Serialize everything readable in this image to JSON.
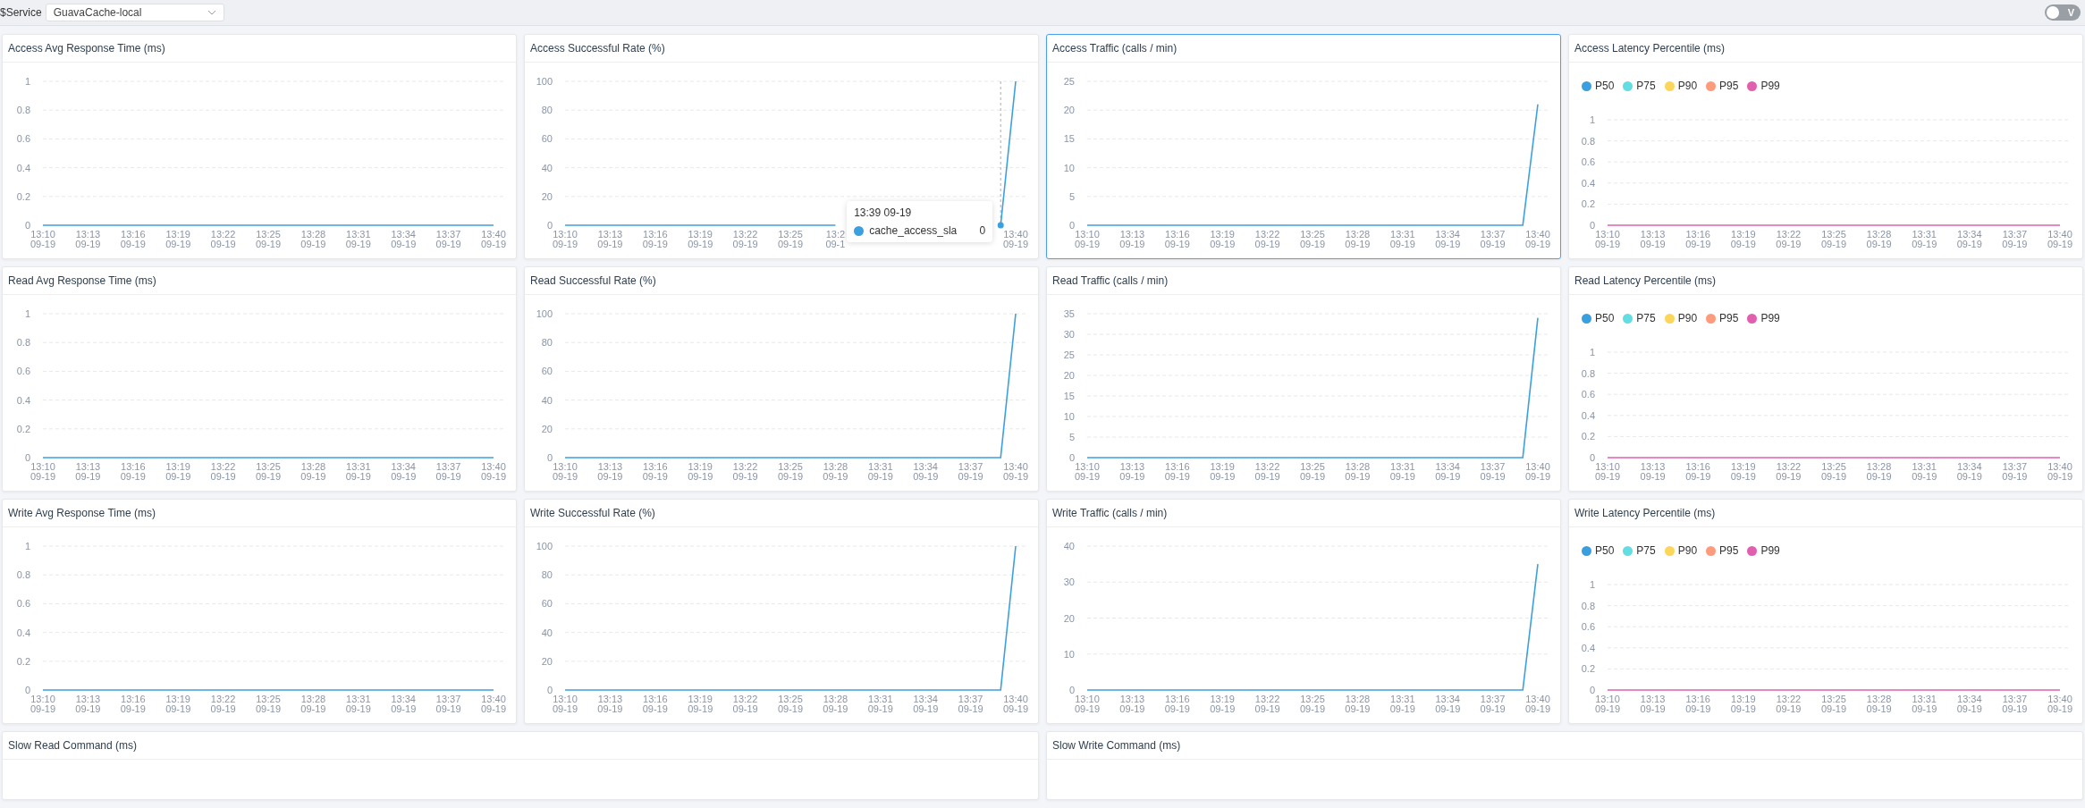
{
  "filter": {
    "label": "$Service",
    "value": "GuavaCache-local"
  },
  "toggle": {
    "label": "V",
    "on": false
  },
  "panels": [
    {
      "title": "Access Avg Response Time (ms)",
      "selected": false,
      "chart_data": {
        "type": "line",
        "grid": true,
        "ylim": [
          0,
          1
        ],
        "yticks": [
          0,
          0.2,
          0.4,
          0.6,
          0.8,
          1
        ],
        "categories": [
          "13:10\n09-19",
          null,
          null,
          "13:13\n09-19",
          null,
          null,
          "13:16\n09-19",
          null,
          null,
          "13:19\n09-19",
          null,
          null,
          "13:22\n09-19",
          null,
          null,
          "13:25\n09-19",
          null,
          null,
          "13:28\n09-19",
          null,
          null,
          "13:31\n09-19",
          null,
          null,
          "13:34\n09-19",
          null,
          null,
          "13:37\n09-19",
          null,
          null,
          "13:40\n09-19"
        ],
        "series": [
          {
            "color": "#3ba0e0",
            "values": [
              0,
              0,
              0,
              0,
              0,
              0,
              0,
              0,
              0,
              0,
              0,
              0,
              0,
              0,
              0,
              0,
              0,
              0,
              0,
              0,
              0,
              0,
              0,
              0,
              0,
              0,
              0,
              0,
              0,
              0,
              0
            ]
          }
        ]
      }
    },
    {
      "title": "Access Successful Rate (%)",
      "selected": false,
      "chart_data": {
        "type": "line",
        "grid": true,
        "ylim": [
          0,
          100
        ],
        "yticks": [
          0,
          20,
          40,
          60,
          80,
          100
        ],
        "categories": [
          "13:10\n09-19",
          null,
          null,
          "13:13\n09-19",
          null,
          null,
          "13:16\n09-19",
          null,
          null,
          "13:19\n09-19",
          null,
          null,
          "13:22\n09-19",
          null,
          null,
          "13:25\n09-19",
          null,
          null,
          "13:2\n09-1",
          null,
          null,
          null,
          null,
          null,
          null,
          null,
          null,
          null,
          null,
          null,
          "13:40\n09-19"
        ],
        "series": [
          {
            "color": "#3ba0e0",
            "values": [
              0,
              0,
              0,
              0,
              0,
              0,
              0,
              0,
              0,
              0,
              0,
              0,
              0,
              0,
              0,
              0,
              0,
              0,
              0,
              null,
              null,
              null,
              null,
              null,
              null,
              null,
              null,
              null,
              null,
              0,
              100
            ]
          }
        ]
      },
      "tooltip": {
        "title": "13:39 09-19",
        "items": [
          {
            "name": "cache_access_sla",
            "value": "0",
            "color": "#3ba0e0"
          }
        ]
      }
    },
    {
      "title": "Access Traffic (calls / min)",
      "selected": true,
      "chart_data": {
        "type": "line",
        "grid": true,
        "ylim": [
          0,
          25
        ],
        "yticks": [
          0,
          5,
          10,
          15,
          20,
          25
        ],
        "categories": [
          "13:10\n09-19",
          null,
          null,
          "13:13\n09-19",
          null,
          null,
          "13:16\n09-19",
          null,
          null,
          "13:19\n09-19",
          null,
          null,
          "13:22\n09-19",
          null,
          null,
          "13:25\n09-19",
          null,
          null,
          "13:28\n09-19",
          null,
          null,
          "13:31\n09-19",
          null,
          null,
          "13:34\n09-19",
          null,
          null,
          "13:37\n09-19",
          null,
          null,
          "13:40\n09-19"
        ],
        "series": [
          {
            "color": "#3ba0e0",
            "values": [
              0,
              0,
              0,
              0,
              0,
              0,
              0,
              0,
              0,
              0,
              0,
              0,
              0,
              0,
              0,
              0,
              0,
              0,
              0,
              0,
              0,
              0,
              0,
              0,
              0,
              0,
              0,
              0,
              0,
              0,
              21
            ]
          }
        ]
      }
    },
    {
      "title": "Access Latency Percentile (ms)",
      "selected": false,
      "legend": true,
      "chart_data": {
        "type": "line",
        "grid": true,
        "ylim": [
          0,
          1
        ],
        "yticks": [
          0,
          0.2,
          0.4,
          0.6,
          0.8,
          1
        ],
        "categories": [
          "13:10\n09-19",
          null,
          null,
          "13:13\n09-19",
          null,
          null,
          "13:16\n09-19",
          null,
          null,
          "13:19\n09-19",
          null,
          null,
          "13:22\n09-19",
          null,
          null,
          "13:25\n09-19",
          null,
          null,
          "13:28\n09-19",
          null,
          null,
          "13:31\n09-19",
          null,
          null,
          "13:34\n09-19",
          null,
          null,
          "13:37\n09-19",
          null,
          null,
          "13:40\n09-19"
        ],
        "series": [
          {
            "name": "P50",
            "color": "#3a9fde",
            "values": [
              null,
              null,
              null,
              null,
              null,
              null,
              null,
              null,
              null,
              null,
              null,
              null,
              null,
              null,
              null,
              null,
              null,
              null,
              null,
              null,
              null,
              null,
              null,
              null,
              null,
              null,
              null,
              null,
              null,
              null,
              null
            ]
          },
          {
            "name": "P75",
            "color": "#62dde1",
            "values": [
              null,
              null,
              null,
              null,
              null,
              null,
              null,
              null,
              null,
              null,
              null,
              null,
              null,
              null,
              null,
              null,
              null,
              null,
              null,
              null,
              null,
              null,
              null,
              null,
              null,
              null,
              null,
              null,
              null,
              null,
              null
            ]
          },
          {
            "name": "P90",
            "color": "#fcd65c",
            "values": [
              null,
              null,
              null,
              null,
              null,
              null,
              null,
              null,
              null,
              null,
              null,
              null,
              null,
              null,
              null,
              null,
              null,
              null,
              null,
              null,
              null,
              null,
              null,
              null,
              null,
              null,
              null,
              null,
              null,
              null,
              null
            ]
          },
          {
            "name": "P95",
            "color": "#fd9b7d",
            "values": [
              null,
              null,
              null,
              null,
              null,
              null,
              null,
              null,
              null,
              null,
              null,
              null,
              null,
              null,
              null,
              null,
              null,
              null,
              null,
              null,
              null,
              null,
              null,
              null,
              null,
              null,
              null,
              null,
              null,
              null,
              null
            ]
          },
          {
            "name": "P99",
            "color": "#e060ae",
            "values": [
              0,
              0,
              0,
              0,
              0,
              0,
              0,
              0,
              0,
              0,
              0,
              0,
              0,
              0,
              0,
              0,
              0,
              0,
              0,
              0,
              0,
              0,
              0,
              0,
              0,
              0,
              0,
              0,
              0,
              0,
              0
            ]
          }
        ]
      }
    },
    {
      "title": "Read Avg Response Time (ms)",
      "selected": false,
      "chart_data": {
        "type": "line",
        "grid": true,
        "ylim": [
          0,
          1
        ],
        "yticks": [
          0,
          0.2,
          0.4,
          0.6,
          0.8,
          1
        ],
        "categories": [
          "13:10\n09-19",
          null,
          null,
          "13:13\n09-19",
          null,
          null,
          "13:16\n09-19",
          null,
          null,
          "13:19\n09-19",
          null,
          null,
          "13:22\n09-19",
          null,
          null,
          "13:25\n09-19",
          null,
          null,
          "13:28\n09-19",
          null,
          null,
          "13:31\n09-19",
          null,
          null,
          "13:34\n09-19",
          null,
          null,
          "13:37\n09-19",
          null,
          null,
          "13:40\n09-19"
        ],
        "series": [
          {
            "color": "#3ba0e0",
            "values": [
              0,
              0,
              0,
              0,
              0,
              0,
              0,
              0,
              0,
              0,
              0,
              0,
              0,
              0,
              0,
              0,
              0,
              0,
              0,
              0,
              0,
              0,
              0,
              0,
              0,
              0,
              0,
              0,
              0,
              0,
              0
            ]
          }
        ]
      }
    },
    {
      "title": "Read Successful Rate (%)",
      "selected": false,
      "chart_data": {
        "type": "line",
        "grid": true,
        "ylim": [
          0,
          100
        ],
        "yticks": [
          0,
          20,
          40,
          60,
          80,
          100
        ],
        "categories": [
          "13:10\n09-19",
          null,
          null,
          "13:13\n09-19",
          null,
          null,
          "13:16\n09-19",
          null,
          null,
          "13:19\n09-19",
          null,
          null,
          "13:22\n09-19",
          null,
          null,
          "13:25\n09-19",
          null,
          null,
          "13:28\n09-19",
          null,
          null,
          "13:31\n09-19",
          null,
          null,
          "13:34\n09-19",
          null,
          null,
          "13:37\n09-19",
          null,
          null,
          "13:40\n09-19"
        ],
        "series": [
          {
            "color": "#3ba0e0",
            "values": [
              0,
              0,
              0,
              0,
              0,
              0,
              0,
              0,
              0,
              0,
              0,
              0,
              0,
              0,
              0,
              0,
              0,
              0,
              0,
              0,
              0,
              0,
              0,
              0,
              0,
              0,
              0,
              0,
              0,
              0,
              100
            ]
          }
        ]
      }
    },
    {
      "title": "Read Traffic (calls / min)",
      "selected": false,
      "chart_data": {
        "type": "line",
        "grid": true,
        "ylim": [
          0,
          35
        ],
        "yticks": [
          0,
          5,
          10,
          15,
          20,
          25,
          30,
          35
        ],
        "categories": [
          "13:10\n09-19",
          null,
          null,
          "13:13\n09-19",
          null,
          null,
          "13:16\n09-19",
          null,
          null,
          "13:19\n09-19",
          null,
          null,
          "13:22\n09-19",
          null,
          null,
          "13:25\n09-19",
          null,
          null,
          "13:28\n09-19",
          null,
          null,
          "13:31\n09-19",
          null,
          null,
          "13:34\n09-19",
          null,
          null,
          "13:37\n09-19",
          null,
          null,
          "13:40\n09-19"
        ],
        "series": [
          {
            "color": "#3ba0e0",
            "values": [
              0,
              0,
              0,
              0,
              0,
              0,
              0,
              0,
              0,
              0,
              0,
              0,
              0,
              0,
              0,
              0,
              0,
              0,
              0,
              0,
              0,
              0,
              0,
              0,
              0,
              0,
              0,
              0,
              0,
              0,
              34
            ]
          }
        ]
      }
    },
    {
      "title": "Read Latency Percentile (ms)",
      "selected": false,
      "legend": true,
      "chart_data": {
        "type": "line",
        "grid": true,
        "ylim": [
          0,
          1
        ],
        "yticks": [
          0,
          0.2,
          0.4,
          0.6,
          0.8,
          1
        ],
        "categories": [
          "13:10\n09-19",
          null,
          null,
          "13:13\n09-19",
          null,
          null,
          "13:16\n09-19",
          null,
          null,
          "13:19\n09-19",
          null,
          null,
          "13:22\n09-19",
          null,
          null,
          "13:25\n09-19",
          null,
          null,
          "13:28\n09-19",
          null,
          null,
          "13:31\n09-19",
          null,
          null,
          "13:34\n09-19",
          null,
          null,
          "13:37\n09-19",
          null,
          null,
          "13:40\n09-19"
        ],
        "series": [
          {
            "name": "P50",
            "color": "#3a9fde",
            "values": [
              null,
              null,
              null,
              null,
              null,
              null,
              null,
              null,
              null,
              null,
              null,
              null,
              null,
              null,
              null,
              null,
              null,
              null,
              null,
              null,
              null,
              null,
              null,
              null,
              null,
              null,
              null,
              null,
              null,
              null,
              null
            ]
          },
          {
            "name": "P75",
            "color": "#62dde1",
            "values": [
              null,
              null,
              null,
              null,
              null,
              null,
              null,
              null,
              null,
              null,
              null,
              null,
              null,
              null,
              null,
              null,
              null,
              null,
              null,
              null,
              null,
              null,
              null,
              null,
              null,
              null,
              null,
              null,
              null,
              null,
              null
            ]
          },
          {
            "name": "P90",
            "color": "#fcd65c",
            "values": [
              null,
              null,
              null,
              null,
              null,
              null,
              null,
              null,
              null,
              null,
              null,
              null,
              null,
              null,
              null,
              null,
              null,
              null,
              null,
              null,
              null,
              null,
              null,
              null,
              null,
              null,
              null,
              null,
              null,
              null,
              null
            ]
          },
          {
            "name": "P95",
            "color": "#fd9b7d",
            "values": [
              null,
              null,
              null,
              null,
              null,
              null,
              null,
              null,
              null,
              null,
              null,
              null,
              null,
              null,
              null,
              null,
              null,
              null,
              null,
              null,
              null,
              null,
              null,
              null,
              null,
              null,
              null,
              null,
              null,
              null,
              null
            ]
          },
          {
            "name": "P99",
            "color": "#e060ae",
            "values": [
              0,
              0,
              0,
              0,
              0,
              0,
              0,
              0,
              0,
              0,
              0,
              0,
              0,
              0,
              0,
              0,
              0,
              0,
              0,
              0,
              0,
              0,
              0,
              0,
              0,
              0,
              0,
              0,
              0,
              0,
              0
            ]
          }
        ]
      }
    },
    {
      "title": "Write Avg Response Time (ms)",
      "selected": false,
      "chart_data": {
        "type": "line",
        "grid": true,
        "ylim": [
          0,
          1
        ],
        "yticks": [
          0,
          0.2,
          0.4,
          0.6,
          0.8,
          1
        ],
        "categories": [
          "13:10\n09-19",
          null,
          null,
          "13:13\n09-19",
          null,
          null,
          "13:16\n09-19",
          null,
          null,
          "13:19\n09-19",
          null,
          null,
          "13:22\n09-19",
          null,
          null,
          "13:25\n09-19",
          null,
          null,
          "13:28\n09-19",
          null,
          null,
          "13:31\n09-19",
          null,
          null,
          "13:34\n09-19",
          null,
          null,
          "13:37\n09-19",
          null,
          null,
          "13:40\n09-19"
        ],
        "series": [
          {
            "color": "#3ba0e0",
            "values": [
              0,
              0,
              0,
              0,
              0,
              0,
              0,
              0,
              0,
              0,
              0,
              0,
              0,
              0,
              0,
              0,
              0,
              0,
              0,
              0,
              0,
              0,
              0,
              0,
              0,
              0,
              0,
              0,
              0,
              0,
              0
            ]
          }
        ]
      }
    },
    {
      "title": "Write Successful Rate (%)",
      "selected": false,
      "chart_data": {
        "type": "line",
        "grid": true,
        "ylim": [
          0,
          100
        ],
        "yticks": [
          0,
          20,
          40,
          60,
          80,
          100
        ],
        "categories": [
          "13:10\n09-19",
          null,
          null,
          "13:13\n09-19",
          null,
          null,
          "13:16\n09-19",
          null,
          null,
          "13:19\n09-19",
          null,
          null,
          "13:22\n09-19",
          null,
          null,
          "13:25\n09-19",
          null,
          null,
          "13:28\n09-19",
          null,
          null,
          "13:31\n09-19",
          null,
          null,
          "13:34\n09-19",
          null,
          null,
          "13:37\n09-19",
          null,
          null,
          "13:40\n09-19"
        ],
        "series": [
          {
            "color": "#3ba0e0",
            "values": [
              0,
              0,
              0,
              0,
              0,
              0,
              0,
              0,
              0,
              0,
              0,
              0,
              0,
              0,
              0,
              0,
              0,
              0,
              0,
              0,
              0,
              0,
              0,
              0,
              0,
              0,
              0,
              0,
              0,
              0,
              100
            ]
          }
        ]
      }
    },
    {
      "title": "Write Traffic (calls / min)",
      "selected": false,
      "chart_data": {
        "type": "line",
        "grid": true,
        "ylim": [
          0,
          40
        ],
        "yticks": [
          0,
          10,
          20,
          30,
          40
        ],
        "categories": [
          "13:10\n09-19",
          null,
          null,
          "13:13\n09-19",
          null,
          null,
          "13:16\n09-19",
          null,
          null,
          "13:19\n09-19",
          null,
          null,
          "13:22\n09-19",
          null,
          null,
          "13:25\n09-19",
          null,
          null,
          "13:28\n09-19",
          null,
          null,
          "13:31\n09-19",
          null,
          null,
          "13:34\n09-19",
          null,
          null,
          "13:37\n09-19",
          null,
          null,
          "13:40\n09-19"
        ],
        "series": [
          {
            "color": "#3ba0e0",
            "values": [
              0,
              0,
              0,
              0,
              0,
              0,
              0,
              0,
              0,
              0,
              0,
              0,
              0,
              0,
              0,
              0,
              0,
              0,
              0,
              0,
              0,
              0,
              0,
              0,
              0,
              0,
              0,
              0,
              0,
              0,
              35
            ]
          }
        ]
      }
    },
    {
      "title": "Write Latency Percentile (ms)",
      "selected": false,
      "legend": true,
      "chart_data": {
        "type": "line",
        "grid": true,
        "ylim": [
          0,
          1
        ],
        "yticks": [
          0,
          0.2,
          0.4,
          0.6,
          0.8,
          1
        ],
        "categories": [
          "13:10\n09-19",
          null,
          null,
          "13:13\n09-19",
          null,
          null,
          "13:16\n09-19",
          null,
          null,
          "13:19\n09-19",
          null,
          null,
          "13:22\n09-19",
          null,
          null,
          "13:25\n09-19",
          null,
          null,
          "13:28\n09-19",
          null,
          null,
          "13:31\n09-19",
          null,
          null,
          "13:34\n09-19",
          null,
          null,
          "13:37\n09-19",
          null,
          null,
          "13:40\n09-19"
        ],
        "series": [
          {
            "name": "P50",
            "color": "#3a9fde",
            "values": [
              null,
              null,
              null,
              null,
              null,
              null,
              null,
              null,
              null,
              null,
              null,
              null,
              null,
              null,
              null,
              null,
              null,
              null,
              null,
              null,
              null,
              null,
              null,
              null,
              null,
              null,
              null,
              null,
              null,
              null,
              null
            ]
          },
          {
            "name": "P75",
            "color": "#62dde1",
            "values": [
              null,
              null,
              null,
              null,
              null,
              null,
              null,
              null,
              null,
              null,
              null,
              null,
              null,
              null,
              null,
              null,
              null,
              null,
              null,
              null,
              null,
              null,
              null,
              null,
              null,
              null,
              null,
              null,
              null,
              null,
              null
            ]
          },
          {
            "name": "P90",
            "color": "#fcd65c",
            "values": [
              null,
              null,
              null,
              null,
              null,
              null,
              null,
              null,
              null,
              null,
              null,
              null,
              null,
              null,
              null,
              null,
              null,
              null,
              null,
              null,
              null,
              null,
              null,
              null,
              null,
              null,
              null,
              null,
              null,
              null,
              null
            ]
          },
          {
            "name": "P95",
            "color": "#fd9b7d",
            "values": [
              null,
              null,
              null,
              null,
              null,
              null,
              null,
              null,
              null,
              null,
              null,
              null,
              null,
              null,
              null,
              null,
              null,
              null,
              null,
              null,
              null,
              null,
              null,
              null,
              null,
              null,
              null,
              null,
              null,
              null,
              null
            ]
          },
          {
            "name": "P99",
            "color": "#e060ae",
            "values": [
              0,
              0,
              0,
              0,
              0,
              0,
              0,
              0,
              0,
              0,
              0,
              0,
              0,
              0,
              0,
              0,
              0,
              0,
              0,
              0,
              0,
              0,
              0,
              0,
              0,
              0,
              0,
              0,
              0,
              0,
              0
            ]
          }
        ]
      }
    }
  ],
  "wide_panels": [
    {
      "title": "Slow Read Command (ms)"
    },
    {
      "title": "Slow Write Command (ms)"
    }
  ]
}
